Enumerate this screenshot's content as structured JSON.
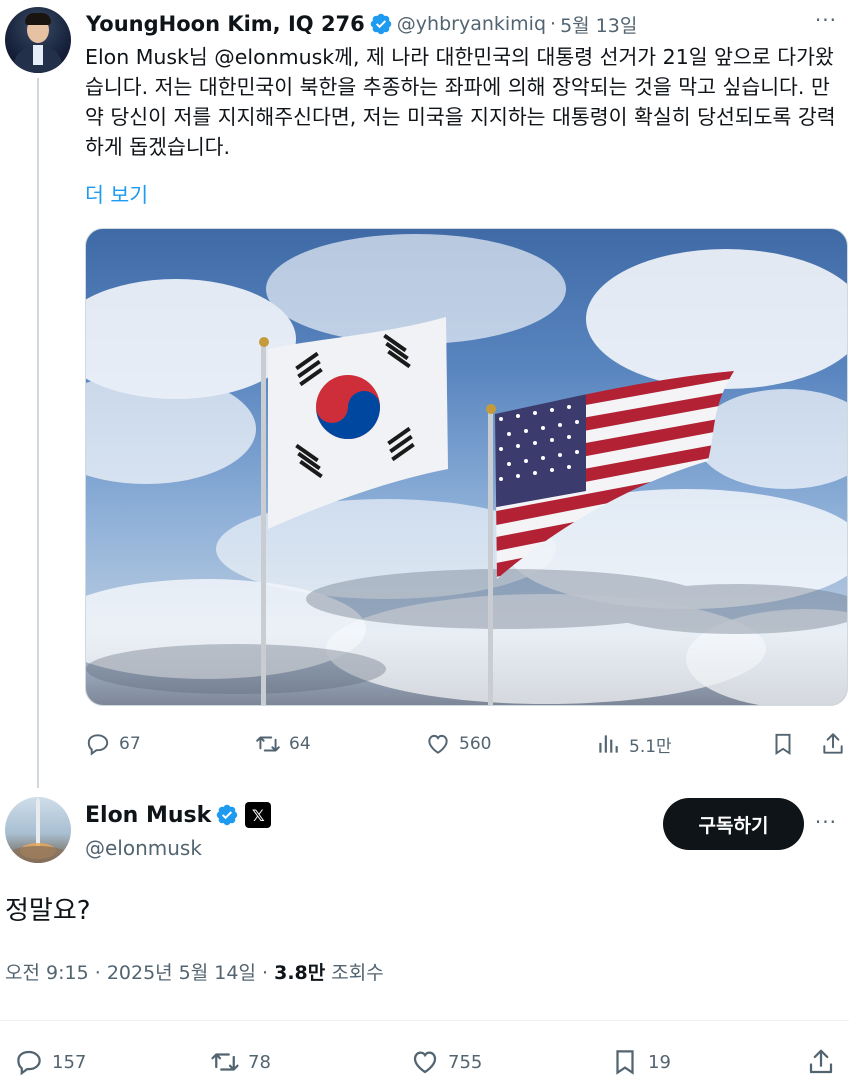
{
  "original_tweet": {
    "author_name": "YoungHoon Kim, IQ 276",
    "author_handle": "@yhbryankimiq",
    "separator": "·",
    "date": "5월 13일",
    "more_label": "···",
    "text": "Elon Musk님 @elonmusk께, 제 나라 대한민국의 대통령 선거가 21일 앞으로 다가왔습니다. 저는 대한민국이 북한을 추종하는 좌파에 의해 장악되는 것을 막고 싶습니다. 만약 당신이 저를 지지해주신다면, 저는 미국을 지지하는 대통령이 확실히 당선되도록 강력하게 돕겠습니다.",
    "show_more": "더 보기",
    "stats": {
      "replies": "67",
      "retweets": "64",
      "likes": "560",
      "views": "5.1만"
    }
  },
  "reply_tweet": {
    "author_name": "Elon Musk",
    "author_handle": "@elonmusk",
    "affiliate_badge": "𝕏",
    "subscribe_label": "구독하기",
    "more_label": "···",
    "text": "정말요?",
    "time": "오전 9:15",
    "date": "2025년 5월 14일",
    "separator": "·",
    "views_count": "3.8만",
    "views_label": "조회수",
    "stats": {
      "replies": "157",
      "retweets": "78",
      "likes": "755",
      "bookmarks": "19"
    }
  },
  "colors": {
    "verified": "#1d9bf0",
    "link": "#1d9bf0",
    "muted": "#536471",
    "text": "#0f1419"
  },
  "icons": [
    "verified-badge-icon",
    "reply-icon",
    "retweet-icon",
    "like-icon",
    "views-icon",
    "bookmark-icon",
    "share-icon",
    "more-icon"
  ]
}
